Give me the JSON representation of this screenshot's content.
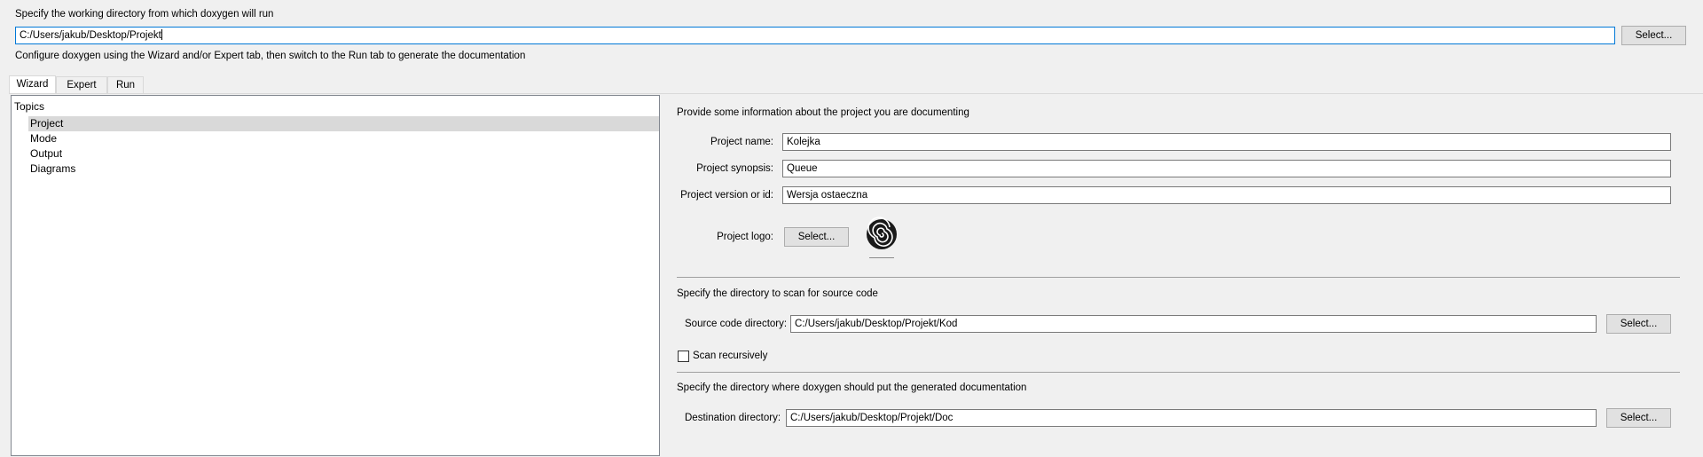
{
  "header": {
    "workdir_prompt": "Specify the working directory from which doxygen will run",
    "workdir_value": "C:/Users/jakub/Desktop/Projekt",
    "select_label": "Select...",
    "configure_hint": "Configure doxygen using the Wizard and/or Expert tab, then switch to the Run tab to generate the documentation"
  },
  "tabs": [
    {
      "label": "Wizard",
      "active": true
    },
    {
      "label": "Expert",
      "active": false
    },
    {
      "label": "Run",
      "active": false
    }
  ],
  "topics": {
    "header": "Topics",
    "items": [
      "Project",
      "Mode",
      "Output",
      "Diagrams"
    ],
    "selected": "Project"
  },
  "project": {
    "intro": "Provide some information about the project you are documenting",
    "name_label": "Project name:",
    "name_value": "Kolejka",
    "synopsis_label": "Project synopsis:",
    "synopsis_value": "Queue",
    "version_label": "Project version or id:",
    "version_value": "Wersja ostaeczna",
    "logo_label": "Project logo:",
    "logo_button": "Select..."
  },
  "source": {
    "intro": "Specify the directory to scan for source code",
    "dir_label": "Source code directory:",
    "dir_value": "C:/Users/jakub/Desktop/Projekt/Kod",
    "select_label": "Select...",
    "recursive_label": "Scan recursively",
    "recursive_checked": false
  },
  "destination": {
    "intro": "Specify the directory where doxygen should put the generated documentation",
    "dir_label": "Destination directory:",
    "dir_value": "C:/Users/jakub/Desktop/Projekt/Doc",
    "select_label": "Select..."
  },
  "colors": {
    "focus_border": "#0078d7",
    "selection_bg": "#cde8ff"
  }
}
